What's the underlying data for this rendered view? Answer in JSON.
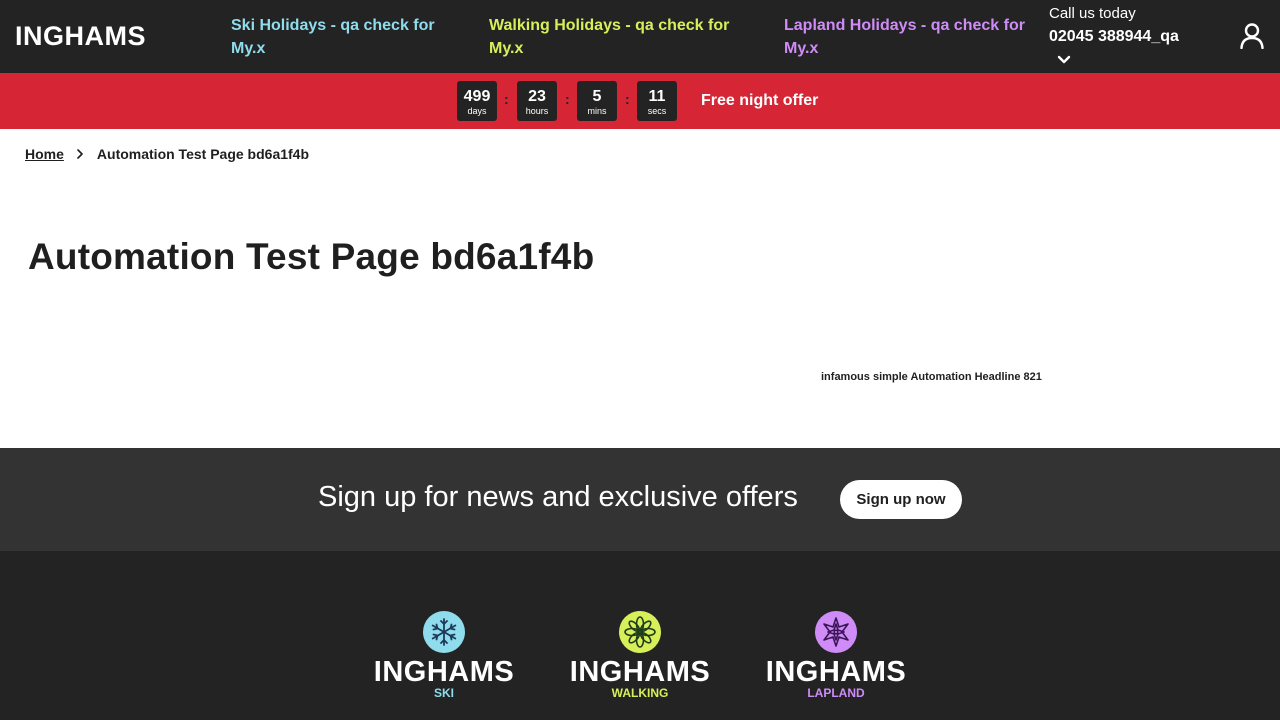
{
  "header": {
    "logo": "INGHAMS",
    "nav": {
      "ski": "Ski Holidays - qa check for My.x",
      "walking": "Walking Holidays - qa check for My.x",
      "lapland": "Lapland Holidays - qa check for My.x"
    },
    "call_label": "Call us today",
    "call_number": "02045 388944_qa",
    "icons": {
      "dropdown": "chevron-down-icon",
      "account": "user-icon"
    }
  },
  "promo": {
    "countdown": [
      {
        "value": "499",
        "unit": "days"
      },
      {
        "value": "23",
        "unit": "hours"
      },
      {
        "value": "5",
        "unit": "mins"
      },
      {
        "value": "11",
        "unit": "secs"
      }
    ],
    "separator": ":",
    "offer": "Free night offer"
  },
  "breadcrumb": {
    "home": "Home",
    "current": "Automation Test Page bd6a1f4b"
  },
  "main": {
    "title": "Automation Test Page bd6a1f4b",
    "headline": "infamous simple Automation Headline 821"
  },
  "signup": {
    "text": "Sign up for news and exclusive offers",
    "button": "Sign up now"
  },
  "footer": {
    "brands": [
      {
        "name": "INGHAMS",
        "sub": "SKI",
        "icon": "snowflake-icon",
        "color": "#8fdcec"
      },
      {
        "name": "INGHAMS",
        "sub": "WALKING",
        "icon": "flower-icon",
        "color": "#d7f05a"
      },
      {
        "name": "INGHAMS",
        "sub": "LAPLAND",
        "icon": "star-icon",
        "color": "#cf8cf7"
      }
    ]
  },
  "colors": {
    "header_bg": "#232323",
    "promo_bg": "#d62535",
    "signup_bg": "#333333",
    "ski": "#8fdcec",
    "walking": "#d7f05a",
    "lapland": "#cf8cf7"
  }
}
